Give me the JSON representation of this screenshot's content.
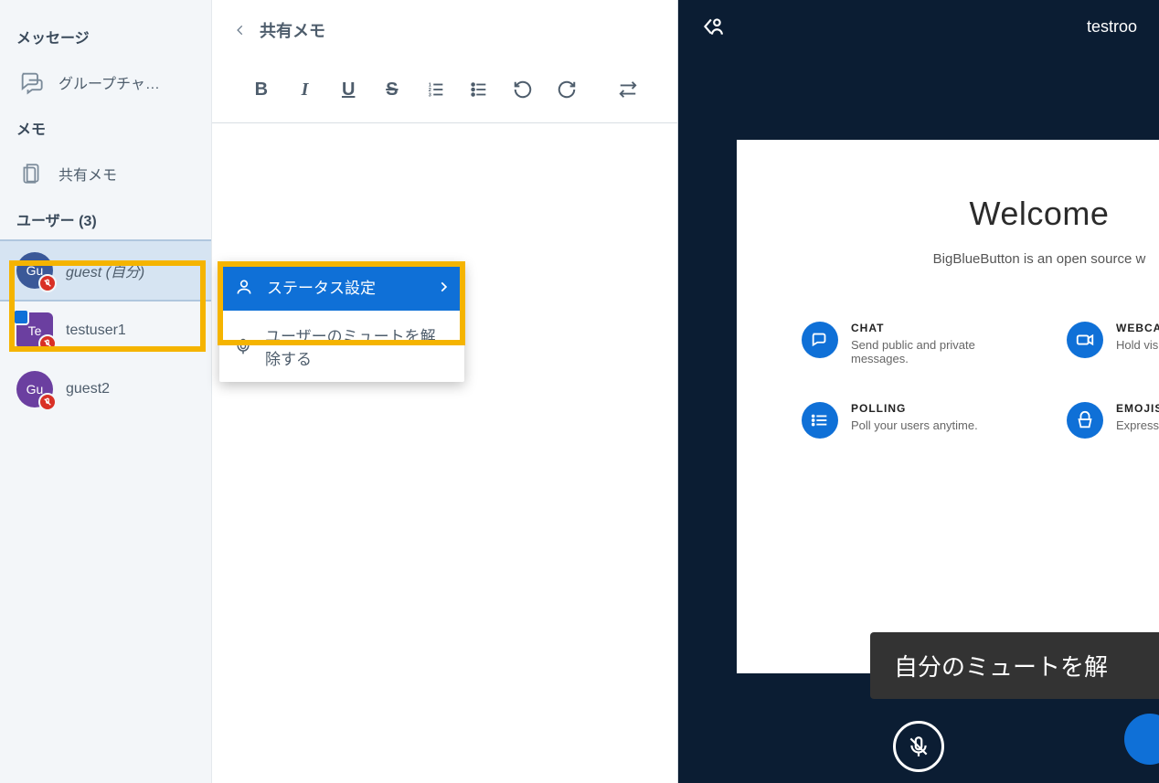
{
  "sidebar": {
    "messages_header": "メッセージ",
    "group_chat_label": "グループチャ…",
    "notes_header": "メモ",
    "shared_notes_label": "共有メモ",
    "users_header": "ユーザー (3)"
  },
  "users": [
    {
      "initials": "Gu",
      "name": "guest (自分)",
      "avatar_color": "blue",
      "shape": "round",
      "muted": true,
      "presenter": false,
      "selected": true
    },
    {
      "initials": "Te",
      "name": "testuser1",
      "avatar_color": "purple",
      "shape": "square",
      "muted": true,
      "presenter": true,
      "selected": false
    },
    {
      "initials": "Gu",
      "name": "guest2",
      "avatar_color": "purple",
      "shape": "round",
      "muted": true,
      "presenter": false,
      "selected": false
    }
  ],
  "notes": {
    "title": "共有メモ"
  },
  "context_menu": {
    "status_label": "ステータス設定",
    "unmute_label": "ユーザーのミュートを解除する"
  },
  "main": {
    "room_title": "testroo",
    "slide": {
      "heading": "Welcome",
      "subtitle": "BigBlueButton is an open source w",
      "features": [
        {
          "title": "CHAT",
          "desc": "Send public and private messages."
        },
        {
          "title": "WEBCAMS",
          "desc": "Hold visual mee"
        },
        {
          "title": "POLLING",
          "desc": "Poll your users anytime."
        },
        {
          "title": "EMOJIS",
          "desc": "Express yoursel"
        }
      ]
    },
    "tooltip": "自分のミュートを解"
  }
}
